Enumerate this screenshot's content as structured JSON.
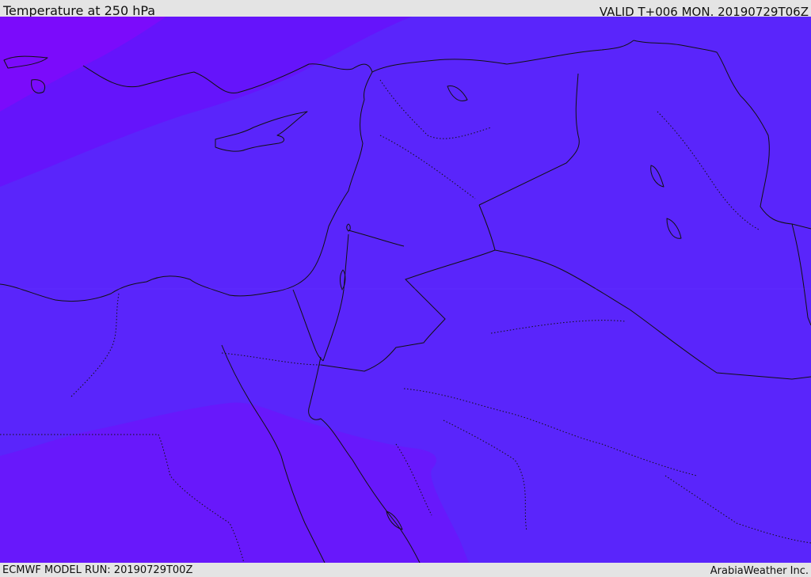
{
  "header": {
    "title": "Temperature at 250 hPa",
    "valid_time": "VALID T+006 MON. 20190729T06Z"
  },
  "footer": {
    "model_run": "ECMWF MODEL RUN: 20190729T00Z",
    "credit": "ArabiaWeather Inc."
  },
  "map": {
    "colors": {
      "base_band": "#5a25fb",
      "mid_band": "#6514fb",
      "cold_band": "#7b0bfb",
      "south_band": "#6818fb",
      "boundary_line": "#111111",
      "frame_background": "#e4e4e4"
    }
  }
}
